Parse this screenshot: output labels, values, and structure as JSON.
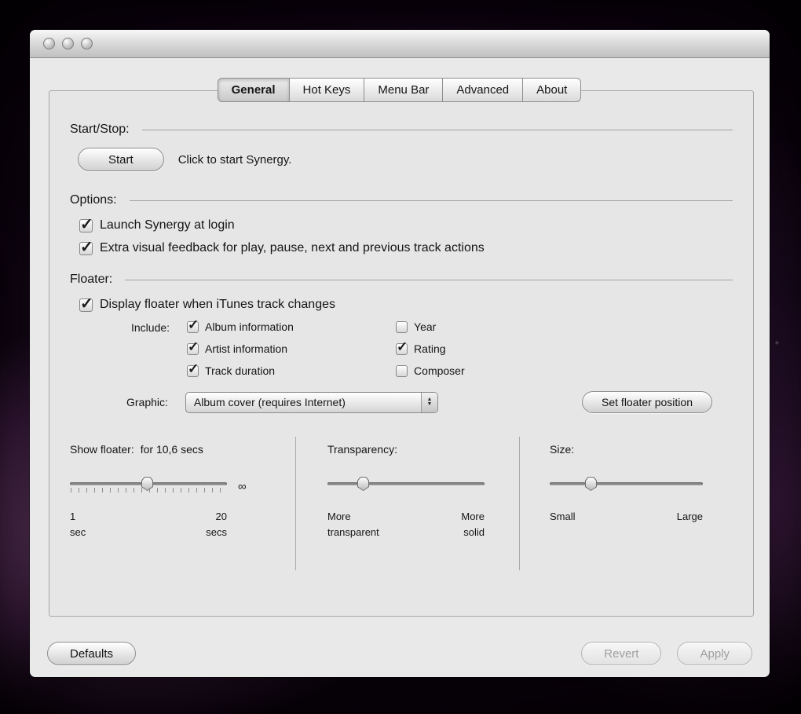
{
  "tabs": [
    {
      "label": "General",
      "active": true
    },
    {
      "label": "Hot Keys",
      "active": false
    },
    {
      "label": "Menu Bar",
      "active": false
    },
    {
      "label": "Advanced",
      "active": false
    },
    {
      "label": "About",
      "active": false
    }
  ],
  "start_stop": {
    "heading": "Start/Stop:",
    "start_button": "Start",
    "hint": "Click to start Synergy."
  },
  "options": {
    "heading": "Options:",
    "launch_at_login": {
      "label": "Launch Synergy at login",
      "checked": true
    },
    "extra_feedback": {
      "label": "Extra visual feedback for play, pause, next and previous track actions",
      "checked": true
    }
  },
  "floater": {
    "heading": "Floater:",
    "display_floater": {
      "label": "Display floater when iTunes track changes",
      "checked": true
    },
    "include_label": "Include:",
    "include": {
      "album_information": {
        "label": "Album information",
        "checked": true
      },
      "artist_information": {
        "label": "Artist information",
        "checked": true
      },
      "track_duration": {
        "label": "Track duration",
        "checked": true
      },
      "year": {
        "label": "Year",
        "checked": false
      },
      "rating": {
        "label": "Rating",
        "checked": true
      },
      "composer": {
        "label": "Composer",
        "checked": false
      }
    },
    "graphic_label": "Graphic:",
    "graphic_selected": "Album cover (requires Internet)",
    "set_floater_position_button": "Set floater position"
  },
  "show_floater": {
    "label": "Show floater:",
    "value": "for 10,6 secs",
    "min_value": "1",
    "min_unit": "sec",
    "max_value": "20",
    "max_unit": "secs",
    "infinity": "∞"
  },
  "transparency": {
    "heading": "Transparency:",
    "min_line1": "More",
    "min_line2": "transparent",
    "max_line1": "More",
    "max_line2": "solid"
  },
  "size": {
    "heading": "Size:",
    "min_label": "Small",
    "max_label": "Large"
  },
  "footer": {
    "defaults_button": "Defaults",
    "revert_button": "Revert",
    "apply_button": "Apply"
  }
}
